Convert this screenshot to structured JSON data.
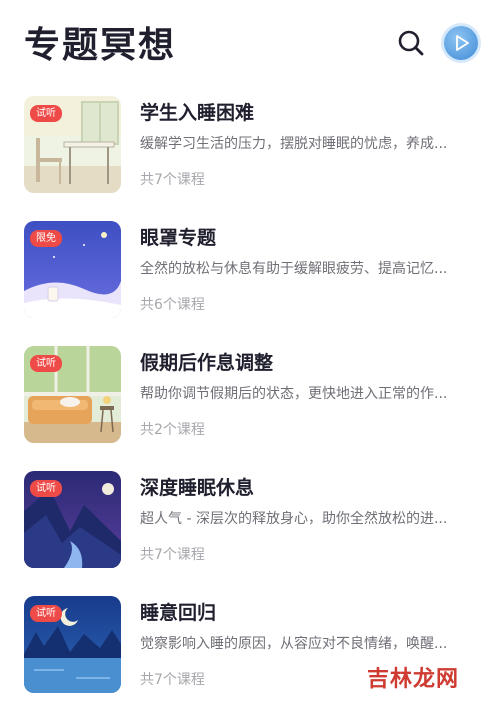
{
  "header": {
    "title": "专题冥想",
    "search_icon": "search-icon",
    "play_icon": "play-icon"
  },
  "colors": {
    "badge": "#ee4b48",
    "title": "#1f1f2e",
    "description": "#6f6f77",
    "count": "#a7a7ad",
    "watermark": "#cf3a31"
  },
  "items": [
    {
      "badge": "试听",
      "title": "学生入睡困难",
      "description": "缓解学习生活的压力，摆脱对睡眠的忧虑，养成...",
      "count": "共7个课程",
      "image": "classroom-desk-illustration"
    },
    {
      "badge": "限免",
      "title": "眼罩专题",
      "description": "全然的放松与休息有助于缓解眼疲劳、提高记忆...",
      "count": "共6个课程",
      "image": "night-sky-bottle-illustration"
    },
    {
      "badge": "试听",
      "title": "假期后作息调整",
      "description": "帮助你调节假期后的状态，更快地进入正常的作...",
      "count": "共2个课程",
      "image": "sofa-cat-illustration"
    },
    {
      "badge": "试听",
      "title": "深度睡眠休息",
      "description": "超人气 - 深层次的释放身心，助你全然放松的进...",
      "count": "共7个课程",
      "image": "mountain-river-moon-illustration"
    },
    {
      "badge": "试听",
      "title": "睡意回归",
      "description": "觉察影响入睡的原因，从容应对不良情绪，唤醒...",
      "count": "共7个课程",
      "image": "moon-lake-illustration"
    }
  ],
  "watermark": "吉林龙网"
}
